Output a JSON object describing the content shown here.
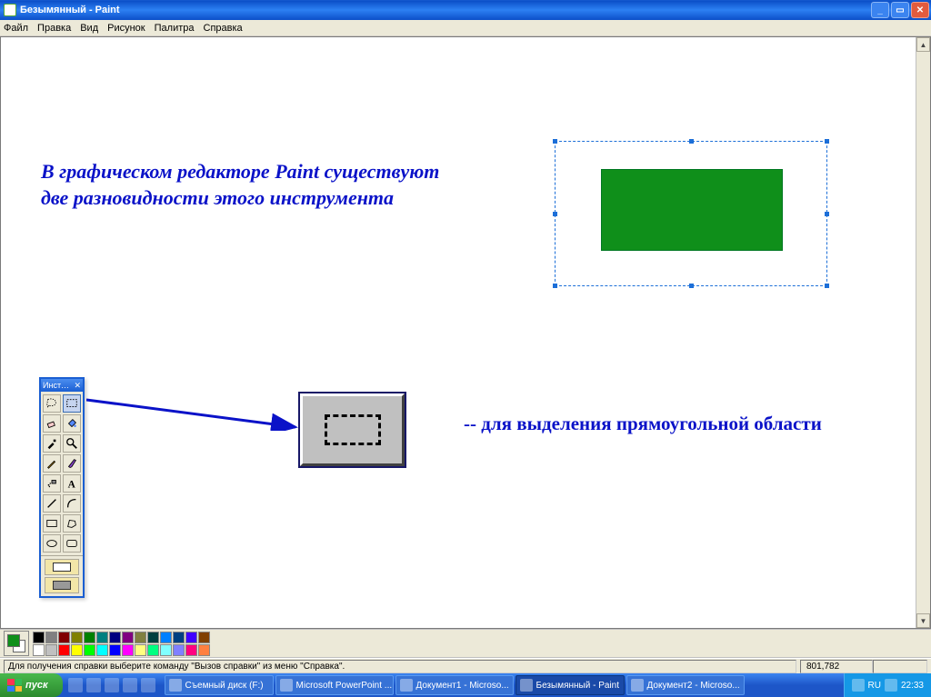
{
  "titlebar": {
    "title": "Безымянный - Paint"
  },
  "menu": {
    "file": "Файл",
    "edit": "Правка",
    "view": "Вид",
    "image": "Рисунок",
    "palette": "Палитра",
    "help": "Справка"
  },
  "canvas": {
    "headline": "В графическом редакторе  Paint существуют две разновидности этого инструмента",
    "caption_prefix": "--  ",
    "caption": "для выделения прямоугольной области"
  },
  "toolbox": {
    "title": "Инст…"
  },
  "statusbar": {
    "help": "Для получения справки выберите команду \"Вызов справки\" из меню \"Справка\".",
    "coords": "801,782"
  },
  "palette": {
    "row1": [
      "#000000",
      "#808080",
      "#800000",
      "#808000",
      "#008000",
      "#008080",
      "#000080",
      "#800080",
      "#808040",
      "#004040",
      "#0080ff",
      "#004080",
      "#4000ff",
      "#804000"
    ],
    "row2": [
      "#ffffff",
      "#c0c0c0",
      "#ff0000",
      "#ffff00",
      "#00ff00",
      "#00ffff",
      "#0000ff",
      "#ff00ff",
      "#ffff80",
      "#00ff80",
      "#80ffff",
      "#8080ff",
      "#ff0080",
      "#ff8040"
    ]
  },
  "taskbar": {
    "start": "пуск",
    "items": [
      "Съемный диск (F:)",
      "Microsoft PowerPoint ...",
      "Документ1 - Microso...",
      "Безымянный - Paint",
      "Документ2 - Microso..."
    ],
    "active_index": 3,
    "tray": {
      "lang": "RU",
      "clock": "22:33"
    }
  }
}
